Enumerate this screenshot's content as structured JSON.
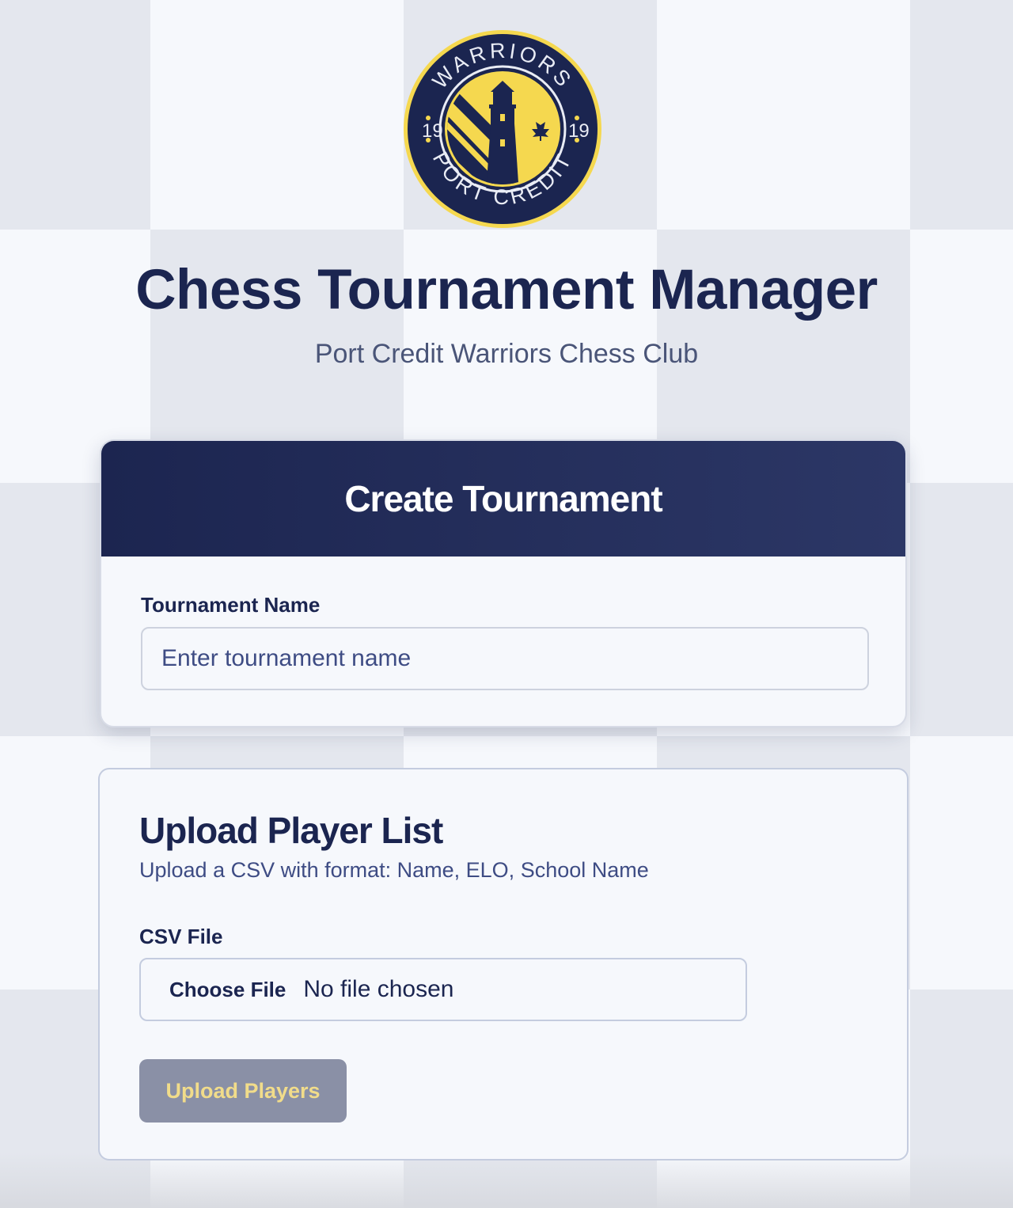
{
  "logo": {
    "top_text": "WARRIORS",
    "bottom_text": "PORT CREDIT",
    "year_left": "19",
    "year_right": "19",
    "colors": {
      "navy": "#1b2550",
      "gold": "#f5d84f"
    }
  },
  "header": {
    "title": "Chess Tournament Manager",
    "subtitle": "Port Credit Warriors Chess Club"
  },
  "create_tournament": {
    "heading": "Create Tournament",
    "name_label": "Tournament Name",
    "name_placeholder": "Enter tournament name",
    "name_value": ""
  },
  "upload_players": {
    "heading": "Upload Player List",
    "description": "Upload a CSV with format: Name, ELO, School Name",
    "file_label": "CSV File",
    "choose_file_label": "Choose File",
    "file_status": "No file chosen",
    "submit_label": "Upload Players"
  },
  "colors": {
    "navy": "#1b2550",
    "accent_gold": "#f1dc8a",
    "disabled_button": "#8a90a6",
    "board_dark": "#e4e7ee",
    "board_light": "#f6f8fc"
  }
}
